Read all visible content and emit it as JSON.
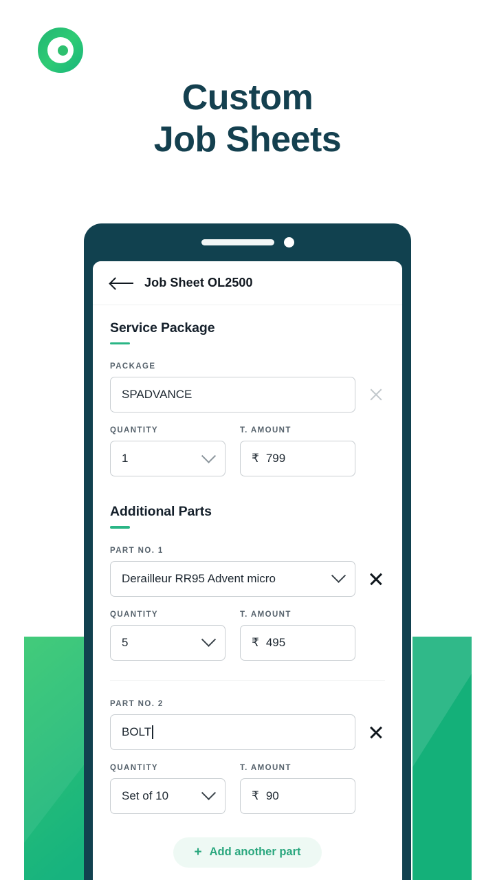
{
  "brand": {
    "logo_icon": "circle-dot-logo",
    "accent_green": "#2ab585",
    "dark_teal": "#11414f"
  },
  "headline": {
    "line1": "Custom",
    "line2": "Job Sheets"
  },
  "phone": {
    "notch": {
      "speaker_icon": "speaker-bar",
      "camera_icon": "camera-dot"
    },
    "appbar": {
      "back_icon": "back-arrow-icon",
      "title": "Job Sheet OL2500"
    }
  },
  "service_package": {
    "heading": "Service Package",
    "package_label": "PACKAGE",
    "package_value": "SPADVANCE",
    "package_clear_icon": "close-icon",
    "quantity_label": "QUANTITY",
    "quantity_value": "1",
    "amount_label": "T. AMOUNT",
    "currency": "₹",
    "amount_value": "799"
  },
  "additional_parts": {
    "heading": "Additional Parts",
    "items": [
      {
        "part_label": "PART NO. 1",
        "part_value": "Derailleur RR95 Advent micro",
        "has_chevron": true,
        "quantity_label": "QUANTITY",
        "quantity_value": "5",
        "amount_label": "T. AMOUNT",
        "currency": "₹",
        "amount_value": "495",
        "remove_icon": "close-icon"
      },
      {
        "part_label": "PART NO. 2",
        "part_value": "BOLT",
        "has_chevron": false,
        "quantity_label": "QUANTITY",
        "quantity_value": "Set of 10",
        "amount_label": "T. AMOUNT",
        "currency": "₹",
        "amount_value": "90",
        "remove_icon": "close-icon"
      }
    ],
    "add_button": {
      "plus_icon": "plus-icon",
      "label": "Add another part"
    }
  }
}
